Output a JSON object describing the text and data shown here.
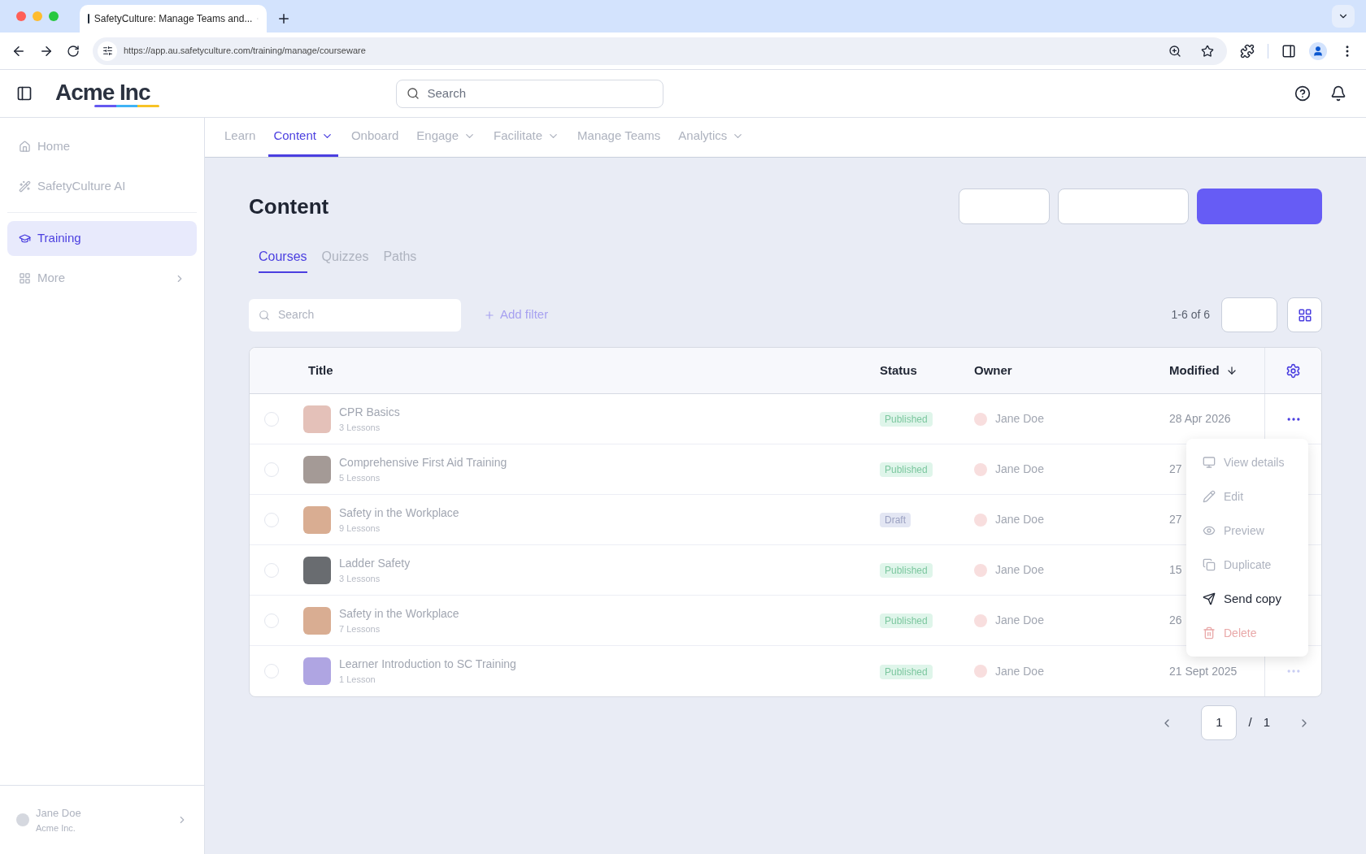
{
  "browser": {
    "tab_title": "SafetyCulture: Manage Teams and...",
    "url": "https://app.au.safetyculture.com/training/manage/courseware"
  },
  "header": {
    "logo": "Acme Inc",
    "search_placeholder": "Search"
  },
  "sidebar": {
    "items": [
      {
        "label": "Home",
        "selected": false,
        "chevron": false
      },
      {
        "label": "SafetyCulture AI",
        "selected": false,
        "chevron": false
      },
      {
        "label": "Training",
        "selected": true,
        "chevron": false
      },
      {
        "label": "More",
        "selected": false,
        "chevron": true
      }
    ],
    "user": {
      "name": "Jane Doe",
      "org": "Acme Inc."
    }
  },
  "nav": [
    {
      "label": "Learn",
      "selected": false,
      "dropdown": false
    },
    {
      "label": "Content",
      "selected": true,
      "dropdown": true
    },
    {
      "label": "Onboard",
      "selected": false,
      "dropdown": false
    },
    {
      "label": "Engage",
      "selected": false,
      "dropdown": true
    },
    {
      "label": "Facilitate",
      "selected": false,
      "dropdown": true
    },
    {
      "label": "Manage Teams",
      "selected": false,
      "dropdown": false
    },
    {
      "label": "Analytics",
      "selected": false,
      "dropdown": true
    }
  ],
  "page": {
    "title": "Content"
  },
  "tabs": [
    {
      "label": "Courses",
      "selected": true
    },
    {
      "label": "Quizzes",
      "selected": false
    },
    {
      "label": "Paths",
      "selected": false
    }
  ],
  "toolbar": {
    "search_placeholder": "Search",
    "add_filter": "Add filter",
    "count": "1-6 of 6"
  },
  "table": {
    "columns": [
      "Title",
      "Status",
      "Owner",
      "Modified"
    ],
    "rows": [
      {
        "title": "CPR Basics",
        "lessons": "3 Lessons",
        "status": "Published",
        "owner": "Jane Doe",
        "modified": "28 Apr 2026",
        "checked": false,
        "menu_open": true
      },
      {
        "title": "Comprehensive First Aid Training",
        "lessons": "5 Lessons",
        "status": "Published",
        "owner": "Jane Doe",
        "modified": "27",
        "checked": false
      },
      {
        "title": "Safety in the Workplace",
        "lessons": "9 Lessons",
        "status": "Draft",
        "owner": "Jane Doe",
        "modified": "27",
        "checked": false
      },
      {
        "title": "Ladder Safety",
        "lessons": "3 Lessons",
        "status": "Published",
        "owner": "Jane Doe",
        "modified": "15",
        "checked": false
      },
      {
        "title": "Safety in the Workplace",
        "lessons": "7 Lessons",
        "status": "Published",
        "owner": "Jane Doe",
        "modified": "26",
        "checked": false
      },
      {
        "title": "Learner Introduction to SC Training",
        "lessons": "1 Lesson",
        "status": "Published",
        "owner": "Jane Doe",
        "modified": "21 Sept 2025",
        "checked": false,
        "menu_open": false
      }
    ]
  },
  "menu": [
    {
      "label": "View details",
      "highlighted": false,
      "kind": "normal"
    },
    {
      "label": "Edit",
      "highlighted": false,
      "kind": "normal"
    },
    {
      "label": "Preview",
      "highlighted": false,
      "kind": "normal"
    },
    {
      "label": "Duplicate",
      "highlighted": false,
      "kind": "normal"
    },
    {
      "label": "Send copy",
      "highlighted": true,
      "kind": "normal"
    },
    {
      "label": "Delete",
      "highlighted": false,
      "kind": "danger"
    }
  ],
  "pagination": {
    "page": "1",
    "separator": "/",
    "total": "1"
  }
}
